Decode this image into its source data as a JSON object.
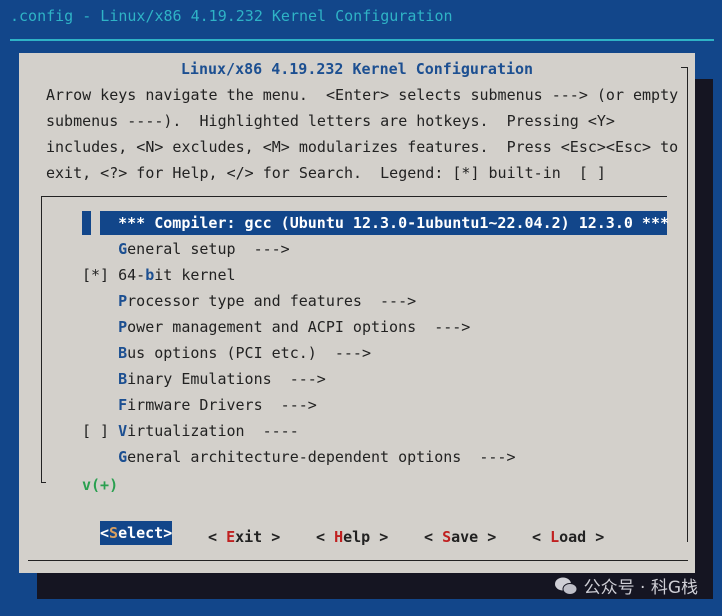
{
  "window_title": ".config - Linux/x86 4.19.232 Kernel Configuration",
  "dialog": {
    "title": "Linux/x86 4.19.232 Kernel Configuration",
    "help_lines": [
      "Arrow keys navigate the menu.  <Enter> selects submenus ---> (or empty",
      "submenus ----).  Highlighted letters are hotkeys.  Pressing <Y>",
      "includes, <N> excludes, <M> modularizes features.  Press <Esc><Esc> to",
      "exit, <?> for Help, </> for Search.  Legend: [*] built-in  [ ]"
    ]
  },
  "menu": {
    "items": [
      {
        "prefix": "",
        "text": "*** Compiler: gcc (Ubuntu 12.3.0-1ubuntu1~22.04.2) 12.3.0 ***",
        "hotkey": -1,
        "selected": true
      },
      {
        "prefix": "",
        "text": "General setup  --->",
        "hotkey": 0
      },
      {
        "prefix": "[*]",
        "text": "64-bit kernel",
        "hotkey": 3
      },
      {
        "prefix": "",
        "text": "Processor type and features  --->",
        "hotkey": 0
      },
      {
        "prefix": "",
        "text": "Power management and ACPI options  --->",
        "hotkey": 0
      },
      {
        "prefix": "",
        "text": "Bus options (PCI etc.)  --->",
        "hotkey": 0
      },
      {
        "prefix": "",
        "text": "Binary Emulations  --->",
        "hotkey": 0
      },
      {
        "prefix": "",
        "text": "Firmware Drivers  --->",
        "hotkey": 0
      },
      {
        "prefix": "[ ]",
        "text": "Virtualization  ----",
        "hotkey": 0
      },
      {
        "prefix": "",
        "text": "General architecture-dependent options  --->",
        "hotkey": 0
      }
    ],
    "more_indicator": "v(+)"
  },
  "buttons": [
    {
      "left": "<",
      "hot": "S",
      "rest": "elect",
      "right": ">",
      "active": true
    },
    {
      "left": "< ",
      "hot": "E",
      "rest": "xit",
      "right": " >"
    },
    {
      "left": "< ",
      "hot": "H",
      "rest": "elp",
      "right": " >"
    },
    {
      "left": "< ",
      "hot": "S",
      "rest": "ave",
      "right": " >"
    },
    {
      "left": "< ",
      "hot": "L",
      "rest": "oad",
      "right": " >"
    }
  ],
  "watermark": "公众号 · 科G栈",
  "colors": {
    "background": "#12468a",
    "dialog": "#d3d0cb",
    "hotkey": "#1c4f91",
    "button_hotkey": "#c02020"
  }
}
